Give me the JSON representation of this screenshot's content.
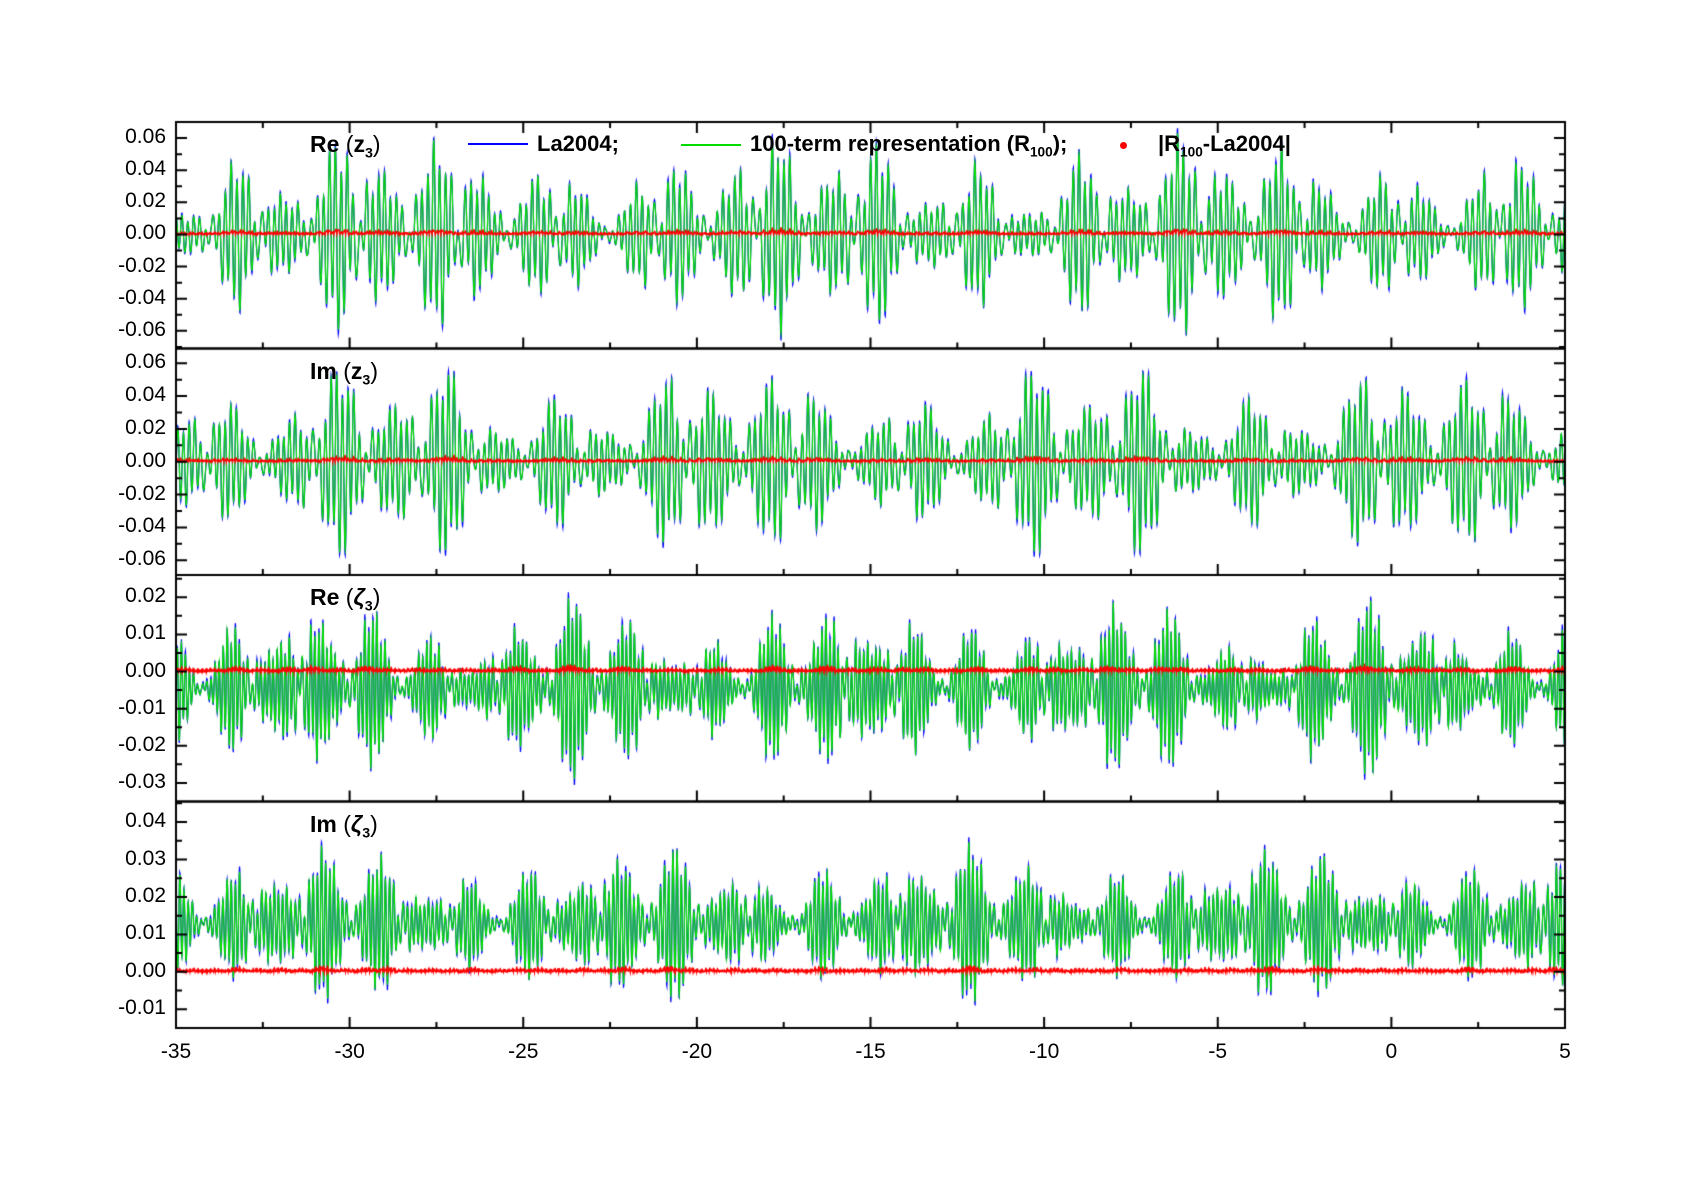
{
  "chart_data": {
    "type": "line",
    "title": "",
    "note": "Four stacked panels comparing La2004 ephemeris series with a 100-term quasi-periodic representation R100 and their absolute difference; dense oscillatory signals over time (Myr), x from -35 to 5.",
    "xlim": [
      -35,
      5
    ],
    "xticks": [
      -35,
      -30,
      -25,
      -20,
      -15,
      -10,
      -5,
      0,
      5
    ],
    "xtick_labels": [
      "-35",
      "-30",
      "-25",
      "-20",
      "-15",
      "-10",
      "-5",
      "0",
      "5"
    ],
    "x_minor_step": 2.5,
    "grid": false,
    "legend_position": "top inside first panel",
    "colors": {
      "la2004": "#0000ff",
      "r100": "#00dc00",
      "diff": "#ff0000",
      "frame": "#000000"
    },
    "legend": [
      {
        "swatch": "line",
        "color": "#0000ff",
        "segments": [
          {
            "t": "La2004;"
          }
        ]
      },
      {
        "swatch": "line",
        "color": "#00dc00",
        "segments": [
          {
            "t": "100-term representation (R"
          },
          {
            "t": "100",
            "sub": 1
          },
          {
            "t": ");"
          }
        ]
      },
      {
        "swatch": "dot",
        "color": "#ff0000",
        "segments": [
          {
            "t": "|R"
          },
          {
            "t": "100",
            "sub": 1
          },
          {
            "t": "-La2004|"
          }
        ]
      }
    ],
    "series_names": [
      "La2004",
      "100-term representation (R100)",
      "|R100-La2004|"
    ],
    "panels": [
      {
        "title_segments": [
          {
            "t": "Re ",
            "b": 1
          },
          {
            "t": "("
          },
          {
            "t": "z",
            "b": 1
          },
          {
            "t": "3",
            "sub": 1,
            "b": 1
          },
          {
            "t": ")"
          }
        ],
        "ylim": [
          -0.071,
          0.07
        ],
        "yticks": [
          0.06,
          0.04,
          0.02,
          0.0,
          -0.02,
          -0.04,
          -0.06
        ],
        "ytick_labels": [
          "0.06",
          "0.04",
          "0.02",
          "0.00",
          "-0.02",
          "-0.04",
          "-0.06"
        ],
        "signal": {
          "center": 0,
          "base_amp": 0.0205,
          "freqs": [
            5.65,
            6.35,
            2.05
          ],
          "weights": [
            1,
            0.62,
            0.35
          ],
          "phases": [
            0.4,
            2.3,
            5.0
          ],
          "env": [
            {
              "f": 0.33,
              "m": 0.42,
              "p": 1.2
            },
            {
              "f": 0.085,
              "m": 0.28,
              "p": 4.4
            }
          ],
          "noise": 0.0009,
          "blue_scale": 1.05
        }
      },
      {
        "title_segments": [
          {
            "t": "Im ",
            "b": 1
          },
          {
            "t": "("
          },
          {
            "t": "z",
            "b": 1
          },
          {
            "t": "3",
            "sub": 1,
            "b": 1
          },
          {
            "t": ")"
          }
        ],
        "ylim": [
          -0.069,
          0.069
        ],
        "yticks": [
          0.06,
          0.04,
          0.02,
          0.0,
          -0.02,
          -0.04,
          -0.06
        ],
        "ytick_labels": [
          "0.06",
          "0.04",
          "0.02",
          "0.00",
          "-0.02",
          "-0.04",
          "-0.06"
        ],
        "signal": {
          "center": 0,
          "base_amp": 0.02,
          "freqs": [
            5.9,
            6.55,
            1.75
          ],
          "weights": [
            1,
            0.6,
            0.33
          ],
          "phases": [
            2.9,
            0.8,
            3.7
          ],
          "env": [
            {
              "f": 0.3,
              "m": 0.4,
              "p": 2.6
            },
            {
              "f": 0.1,
              "m": 0.3,
              "p": 0.9
            }
          ],
          "noise": 0.0009,
          "blue_scale": 1.05
        }
      },
      {
        "title_segments": [
          {
            "t": "Re ",
            "b": 1
          },
          {
            "t": "("
          },
          {
            "t": "ζ",
            "b": 1,
            "i": 1
          },
          {
            "t": "3",
            "sub": 1,
            "b": 1
          },
          {
            "t": ")"
          }
        ],
        "ylim": [
          -0.035,
          0.026
        ],
        "yticks": [
          0.02,
          0.01,
          0.0,
          -0.01,
          -0.02,
          -0.03
        ],
        "ytick_labels": [
          "0.02",
          "0.01",
          "0.00",
          "-0.01",
          "-0.02",
          "-0.03"
        ],
        "signal": {
          "center": -0.0045,
          "base_amp": 0.0078,
          "freqs": [
            8.35,
            9.05,
            3.25
          ],
          "weights": [
            1,
            0.6,
            0.3
          ],
          "phases": [
            1.1,
            4.2,
            2.0
          ],
          "env": [
            {
              "f": 0.52,
              "m": 0.45,
              "p": 3.3
            },
            {
              "f": 0.13,
              "m": 0.3,
              "p": 1.8
            }
          ],
          "noise": 0.0006,
          "blue_scale": 1.05
        }
      },
      {
        "title_segments": [
          {
            "t": "Im ",
            "b": 1
          },
          {
            "t": "("
          },
          {
            "t": "ζ",
            "b": 1,
            "i": 1
          },
          {
            "t": "3",
            "sub": 1,
            "b": 1
          },
          {
            "t": ")"
          }
        ],
        "ylim": [
          -0.015,
          0.0455
        ],
        "yticks": [
          0.04,
          0.03,
          0.02,
          0.01,
          0.0,
          -0.01
        ],
        "ytick_labels": [
          "0.04",
          "0.03",
          "0.02",
          "0.01",
          "0.00",
          "-0.01"
        ],
        "signal": {
          "center": 0.0128,
          "base_amp": 0.007,
          "freqs": [
            8.1,
            8.8,
            2.95
          ],
          "weights": [
            1,
            0.58,
            0.3
          ],
          "phases": [
            5.3,
            1.9,
            0.6
          ],
          "env": [
            {
              "f": 0.48,
              "m": 0.42,
              "p": 0.7
            },
            {
              "f": 0.11,
              "m": 0.3,
              "p": 3.9
            }
          ],
          "noise": 0.0006,
          "blue_scale": 1.05
        }
      }
    ]
  }
}
